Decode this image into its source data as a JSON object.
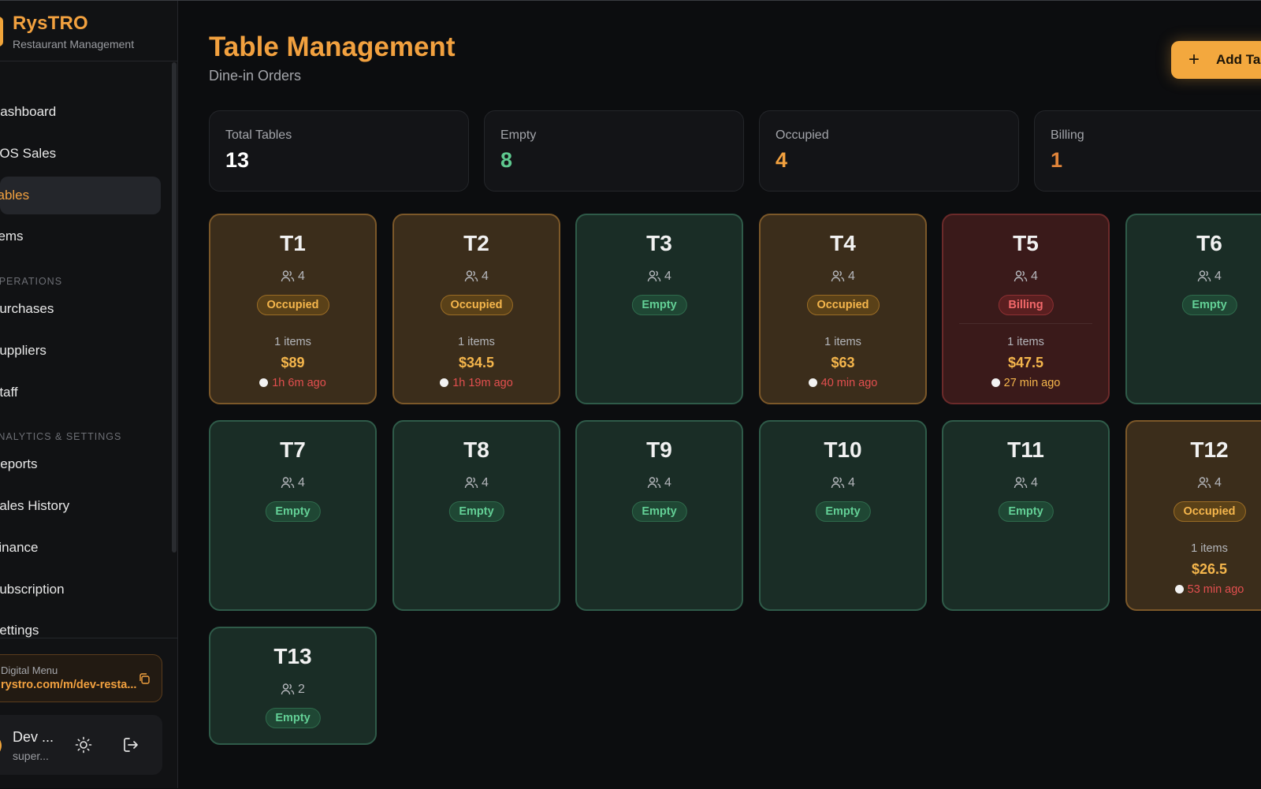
{
  "app": {
    "name": "RysTRO",
    "subtitle": "Restaurant Management"
  },
  "sidebar": {
    "items": [
      {
        "label": "Dashboard",
        "active": false
      },
      {
        "label": "POS Sales",
        "active": false
      },
      {
        "label": "Tables",
        "active": true
      },
      {
        "label": "Items",
        "active": false
      },
      {
        "label": "Purchases",
        "active": false
      },
      {
        "label": "Suppliers",
        "active": false
      },
      {
        "label": "Staff",
        "active": false
      },
      {
        "label": "Reports",
        "active": false
      },
      {
        "label": "Sales History",
        "active": false
      },
      {
        "label": "Finance",
        "active": false
      },
      {
        "label": "Subscription",
        "active": false
      },
      {
        "label": "Settings",
        "active": false
      }
    ],
    "sections": [
      {
        "label": "OPERATIONS"
      },
      {
        "label": "ANALYTICS & SETTINGS"
      }
    ],
    "digital_menu": {
      "title": "Digital Menu",
      "url": "rystro.com/m/dev-resta..."
    },
    "user": {
      "name": "Dev ...",
      "role": "super..."
    }
  },
  "header": {
    "title": "Table Management",
    "subtitle": "Dine-in Orders",
    "add_button_label": "Add Table"
  },
  "stats": [
    {
      "label": "Total Tables",
      "value": "13",
      "color": "#ffffff"
    },
    {
      "label": "Empty",
      "value": "8",
      "color": "#5ec98f"
    },
    {
      "label": "Occupied",
      "value": "4",
      "color": "#f2a13f"
    },
    {
      "label": "Billing",
      "value": "1",
      "color": "#e0843a"
    }
  ],
  "tables": [
    {
      "name": "T1",
      "seats": "4",
      "status": "Occupied",
      "items": "1 items",
      "amount": "$89",
      "time": "1h 6m ago"
    },
    {
      "name": "T2",
      "seats": "4",
      "status": "Occupied",
      "items": "1 items",
      "amount": "$34.5",
      "time": "1h 19m ago"
    },
    {
      "name": "T3",
      "seats": "4",
      "status": "Empty"
    },
    {
      "name": "T4",
      "seats": "4",
      "status": "Occupied",
      "items": "1 items",
      "amount": "$63",
      "time": "40 min ago"
    },
    {
      "name": "T5",
      "seats": "4",
      "status": "Billing",
      "items": "1 items",
      "amount": "$47.5",
      "time": "27 min ago"
    },
    {
      "name": "T6",
      "seats": "4",
      "status": "Empty"
    },
    {
      "name": "T7",
      "seats": "4",
      "status": "Empty"
    },
    {
      "name": "T8",
      "seats": "4",
      "status": "Empty"
    },
    {
      "name": "T9",
      "seats": "4",
      "status": "Empty"
    },
    {
      "name": "T10",
      "seats": "4",
      "status": "Empty"
    },
    {
      "name": "T11",
      "seats": "4",
      "status": "Empty"
    },
    {
      "name": "T12",
      "seats": "4",
      "status": "Occupied",
      "items": "1 items",
      "amount": "$26.5",
      "time": "53 min ago"
    },
    {
      "name": "T13",
      "seats": "2",
      "status": "Empty"
    }
  ]
}
